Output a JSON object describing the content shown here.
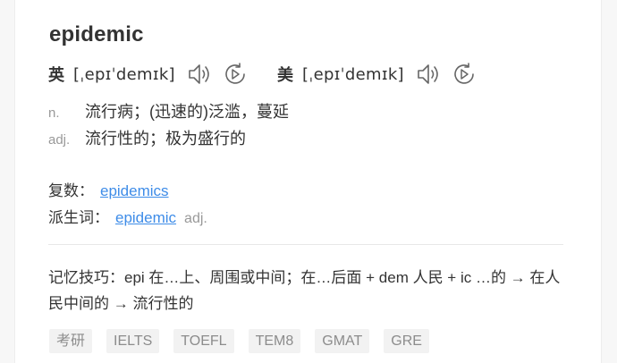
{
  "entry": {
    "word": "epidemic",
    "uk": {
      "region": "英",
      "phonetic": "[ˌepɪˈdemɪk]"
    },
    "us": {
      "region": "美",
      "phonetic": "[ˌepɪˈdemɪk]"
    },
    "definitions": [
      {
        "pos": "n.",
        "meaning": "流行病；(迅速的)泛滥，蔓延"
      },
      {
        "pos": "adj.",
        "meaning": "流行性的；极为盛行的"
      }
    ],
    "plural": {
      "label": "复数：",
      "value": "epidemics"
    },
    "derivative": {
      "label": "派生词：",
      "value": "epidemic",
      "pos": "adj."
    },
    "memory_tip": "记忆技巧：epi 在…上、周围或中间；在…后面 + dem 人民 + ic …的 → 在人民中间的 → 流行性的",
    "tags": [
      "考研",
      "IELTS",
      "TOEFL",
      "TEM8",
      "GMAT",
      "GRE"
    ]
  },
  "icons": {
    "speaker": "speaker-icon",
    "replay": "replay-icon"
  },
  "colors": {
    "link": "#3e8ce8",
    "muted": "#999999",
    "tag_bg": "#f2f2f2"
  }
}
